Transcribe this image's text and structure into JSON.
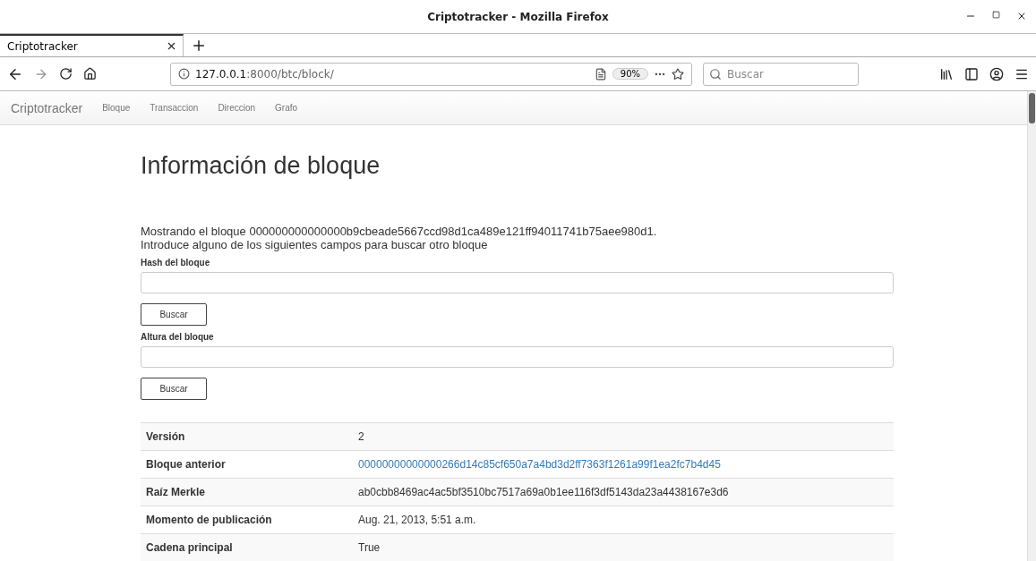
{
  "window": {
    "title": "Criptotracker - Mozilla Firefox"
  },
  "tabs": [
    {
      "label": "Criptotracker",
      "selected": true
    }
  ],
  "address": {
    "host": "127.0.0.1",
    "path": ":8000/btc/block/",
    "zoom": "90%"
  },
  "search": {
    "placeholder": "Buscar"
  },
  "navbar": {
    "brand": "Criptotracker",
    "items": [
      {
        "label": "Bloque"
      },
      {
        "label": "Transaccion"
      },
      {
        "label": "Direccion"
      },
      {
        "label": "Grafo"
      }
    ]
  },
  "page": {
    "title": "Información de bloque",
    "intro": [
      "Mostrando el bloque 000000000000000b9cbeade5667ccd98d1ca489e121ff94011741b75aee980d1.",
      "Introduce alguno de los siguientes campos para buscar otro bloque"
    ],
    "forms": [
      {
        "label": "Hash del bloque",
        "button": "Buscar"
      },
      {
        "label": "Altura del bloque",
        "button": "Buscar"
      }
    ],
    "rows": [
      {
        "name": "Versión",
        "value": "2",
        "kind": "text"
      },
      {
        "name": "Bloque anterior",
        "value": "00000000000000266d14c85cf650a7a4bd3d2ff7363f1261a99f1ea2fc7b4d45",
        "kind": "link"
      },
      {
        "name": "Raíz Merkle",
        "value": "ab0cbb8469ac4ac5bf3510bc7517a69a0b1ee116f3df5143da23a4438167e3d6",
        "kind": "text"
      },
      {
        "name": "Momento de publicación",
        "value": "Aug. 21, 2013, 5:51 a.m.",
        "kind": "text"
      },
      {
        "name": "Cadena principal",
        "value": "True",
        "kind": "text"
      }
    ]
  }
}
